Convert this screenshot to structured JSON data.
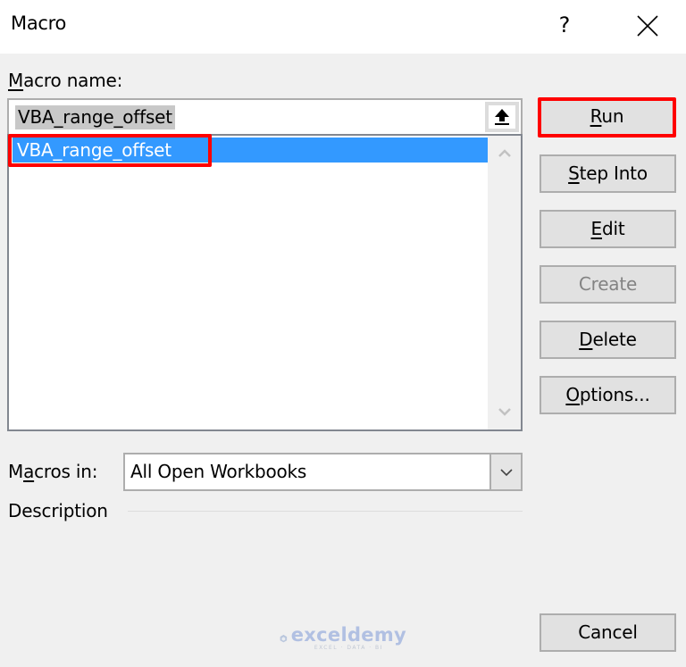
{
  "window": {
    "title": "Macro",
    "help_label": "?",
    "close_icon": "close-icon"
  },
  "macro_name": {
    "label_accel": "M",
    "label_rest": "acro name:",
    "value": "VBA_range_offset",
    "upload_icon": "arrow-up-bar-icon"
  },
  "macro_list": {
    "items": [
      {
        "label": "VBA_range_offset",
        "selected": true
      }
    ],
    "highlight_color": "#ff0000",
    "selection_color": "#3399ff"
  },
  "buttons": {
    "run": {
      "accel": "R",
      "rest": "un",
      "enabled": true,
      "highlighted": true
    },
    "step_into": {
      "accel": "S",
      "rest": "tep Into",
      "enabled": true
    },
    "edit": {
      "accel": "E",
      "rest": "dit",
      "enabled": true
    },
    "create": {
      "label": "Create",
      "enabled": false
    },
    "delete": {
      "accel": "D",
      "rest": "elete",
      "enabled": true
    },
    "options": {
      "accel": "O",
      "rest": "ptions...",
      "enabled": true
    },
    "cancel": {
      "label": "Cancel",
      "enabled": true
    }
  },
  "macros_in": {
    "label_pre": "M",
    "label_accel": "a",
    "label_rest": "cros in:",
    "selected": "All Open Workbooks"
  },
  "description": {
    "label": "Description",
    "text": ""
  },
  "watermark": {
    "name": "exceldemy",
    "tagline": "EXCEL · DATA · BI"
  }
}
